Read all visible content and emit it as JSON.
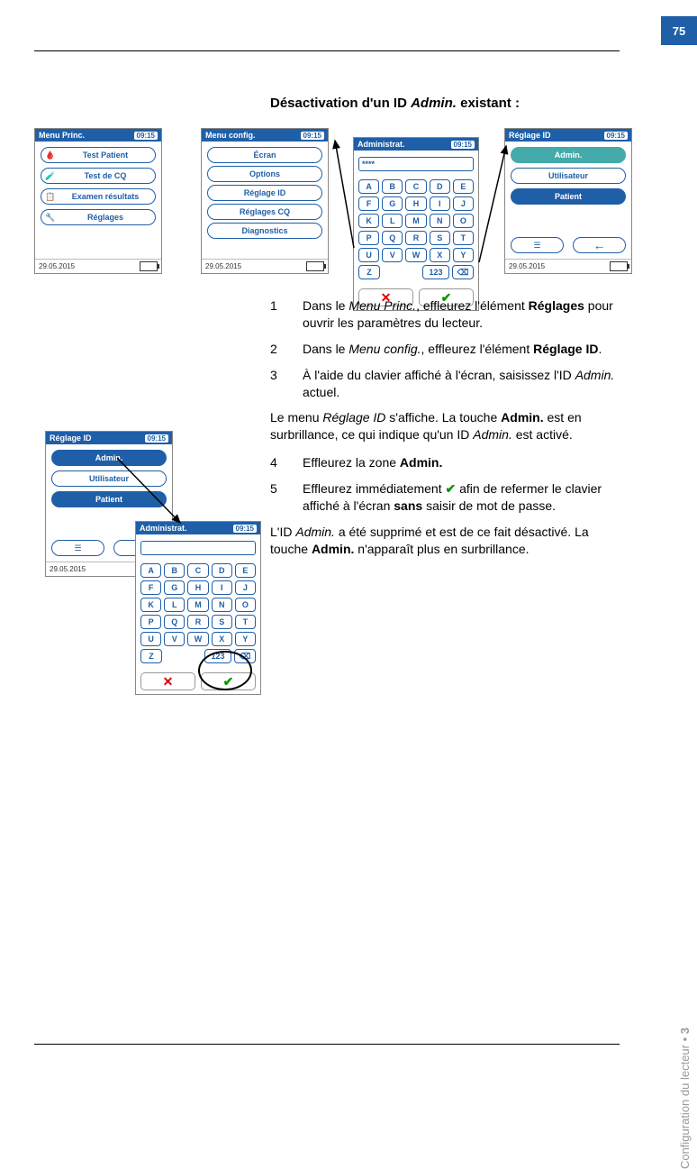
{
  "page_number": "75",
  "section_title_pre": "Désactivation d'un ID ",
  "section_title_em": "Admin.",
  "section_title_post": " existant :",
  "side_label_text": "Configuration du lecteur",
  "side_label_num": "3",
  "common": {
    "time": "09:15",
    "date": "29.05.2015"
  },
  "screen1": {
    "title": "Menu Princ.",
    "items": [
      "Test Patient",
      "Test de CQ",
      "Examen résultats",
      "Réglages"
    ]
  },
  "screen2": {
    "title": "Menu config.",
    "items": [
      "Écran",
      "Options",
      "Réglage ID",
      "Réglages CQ",
      "Diagnostics"
    ]
  },
  "screen_kbd": {
    "title": "Administrat.",
    "input": "****",
    "rows": [
      [
        "A",
        "B",
        "C",
        "D",
        "E"
      ],
      [
        "F",
        "G",
        "H",
        "I",
        "J"
      ],
      [
        "K",
        "L",
        "M",
        "N",
        "O"
      ],
      [
        "P",
        "Q",
        "R",
        "S",
        "T"
      ],
      [
        "U",
        "V",
        "W",
        "X",
        "Y"
      ]
    ],
    "last_row": {
      "z": "Z",
      "num": "123"
    }
  },
  "screen4": {
    "title": "Réglage ID",
    "items": [
      {
        "label": "Admin.",
        "style": "teal"
      },
      {
        "label": "Utilisateur",
        "style": "outline"
      },
      {
        "label": "Patient",
        "style": "solid"
      }
    ]
  },
  "screen5": {
    "title": "Réglage ID",
    "items": [
      {
        "label": "Admin.",
        "style": "solid"
      },
      {
        "label": "Utilisateur",
        "style": "outline"
      },
      {
        "label": "Patient",
        "style": "solid"
      }
    ]
  },
  "screen_kbd2": {
    "title": "Administrat.",
    "input": "",
    "rows": [
      [
        "A",
        "B",
        "C",
        "D",
        "E"
      ],
      [
        "F",
        "G",
        "H",
        "I",
        "J"
      ],
      [
        "K",
        "L",
        "M",
        "N",
        "O"
      ],
      [
        "P",
        "Q",
        "R",
        "S",
        "T"
      ],
      [
        "U",
        "V",
        "W",
        "X",
        "Y"
      ]
    ],
    "last_row": {
      "z": "Z",
      "num": "123"
    }
  },
  "steps": {
    "1": {
      "a": "Dans le ",
      "em1": "Menu Princ.",
      "b": ", effleurez l'élément ",
      "strong": "Réglages",
      "c": " pour ouvrir les paramètres du lecteur."
    },
    "2": {
      "a": "Dans le ",
      "em1": "Menu config.",
      "b": ", effleurez l'élément ",
      "strong": "Réglage ID",
      "c": "."
    },
    "3": {
      "a": "À l'aide du clavier affiché à l'écran, saisissez l'ID ",
      "em1": "Admin.",
      "b": " actuel."
    },
    "para1": {
      "a": "Le menu ",
      "em1": "Réglage ID",
      "b": " s'affiche. La touche ",
      "strong": "Admin.",
      "c": " est en surbrillance, ce qui indique qu'un ID ",
      "em2": "Admin.",
      "d": " est activé."
    },
    "4": {
      "a": "Effleurez la zone ",
      "strong": "Admin."
    },
    "5": {
      "a": "Effleurez immédiatement ",
      "b": " afin de refermer le clavier affiché à l'écran ",
      "strong": "sans",
      "c": " saisir de mot de passe."
    },
    "para2": {
      "a": "L'ID ",
      "em1": "Admin.",
      "b": " a été supprimé et est de ce fait désactivé. La touche ",
      "strong": "Admin.",
      "c": " n'apparaît plus en surbrillance."
    }
  }
}
